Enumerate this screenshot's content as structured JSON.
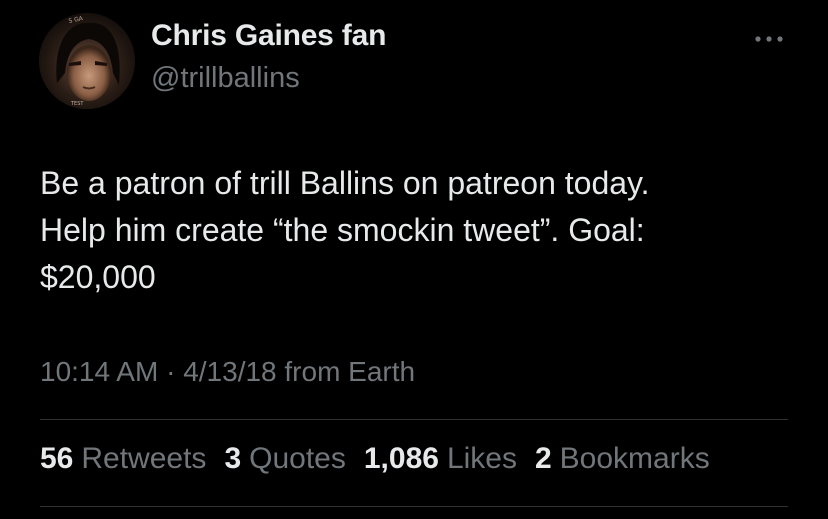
{
  "author": {
    "display_name": "Chris Gaines fan",
    "handle": "@trillballins",
    "avatar_icon": "profile-photo"
  },
  "tweet": {
    "text": "Be a patron of trill Ballins on patreon today.\nHelp him create “the smockin tweet”. Goal:\n$20,000",
    "time": "10:14 AM",
    "separator": " · ",
    "date": "4/13/18",
    "source": " from Earth"
  },
  "stats": {
    "retweets": {
      "count": "56",
      "label": "Retweets"
    },
    "quotes": {
      "count": "3",
      "label": "Quotes"
    },
    "likes": {
      "count": "1,086",
      "label": "Likes"
    },
    "bookmarks": {
      "count": "2",
      "label": "Bookmarks"
    }
  },
  "colors": {
    "background": "#000000",
    "primary_text": "#e7e9ea",
    "secondary_text": "#71767b",
    "divider": "#2f3336"
  },
  "icons": {
    "more": "more-horizontal-icon"
  }
}
